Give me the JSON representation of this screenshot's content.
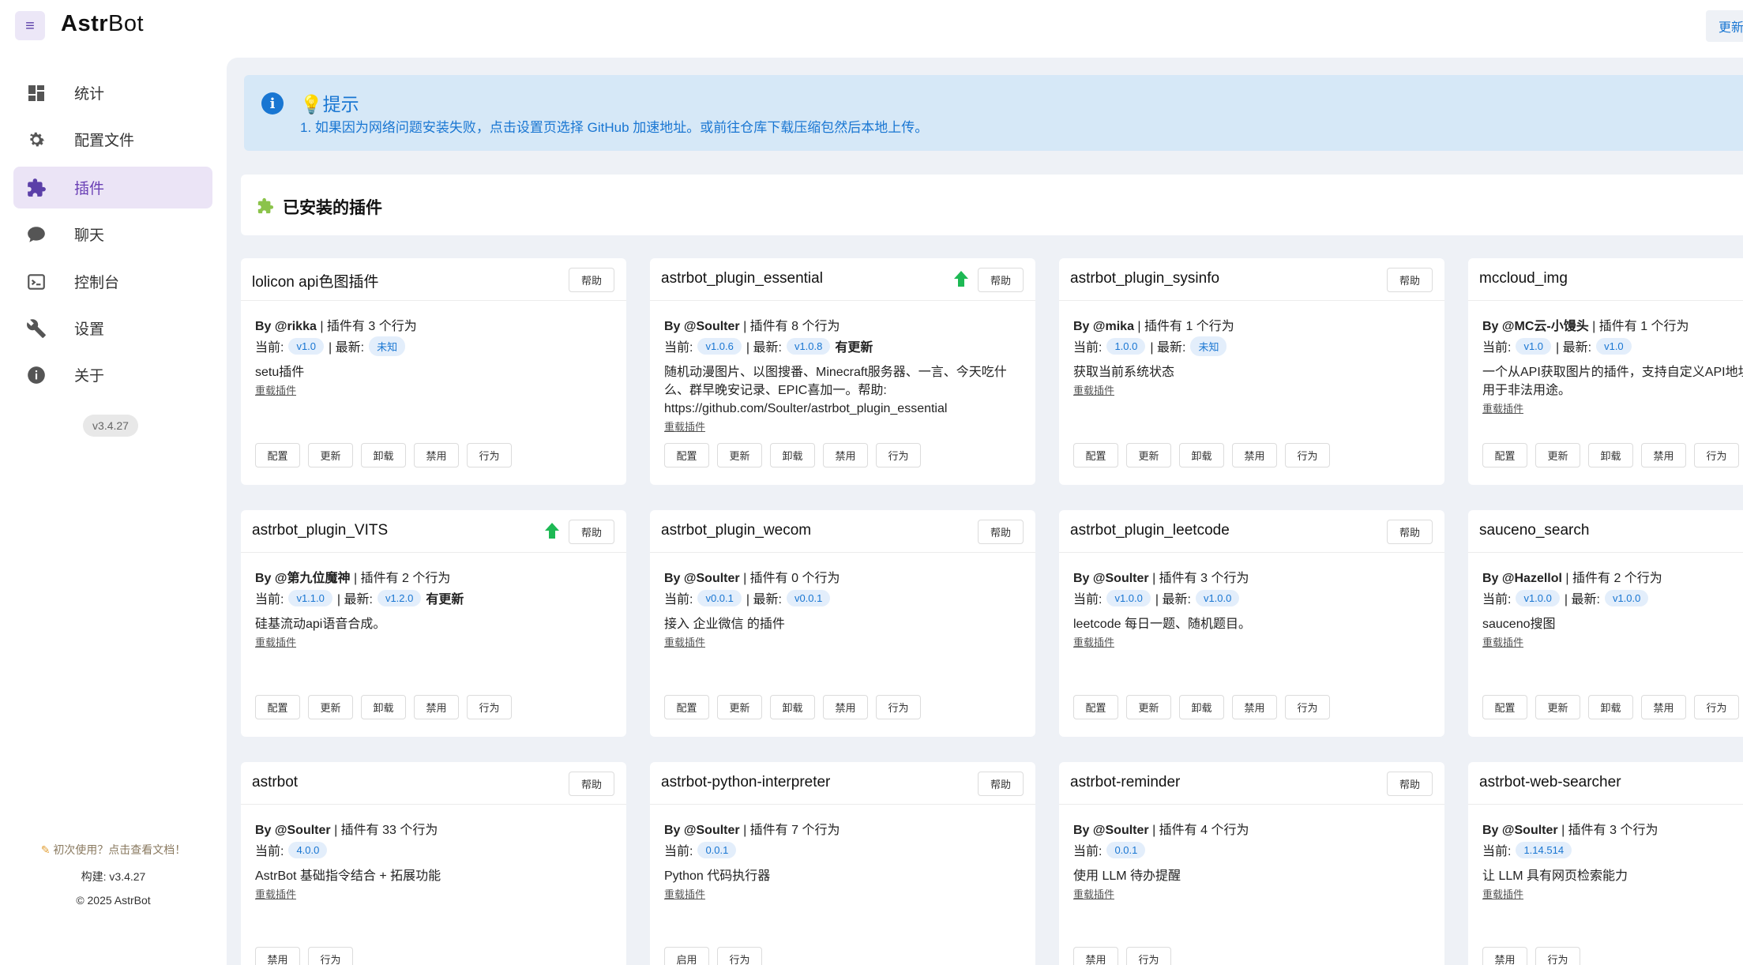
{
  "header": {
    "menu_icon": "≡",
    "logo_bold": "Astr",
    "logo_rest": "Bot",
    "update_label": "更新"
  },
  "sidebar": {
    "items": [
      {
        "label": "统计",
        "icon": "dashboard-icon"
      },
      {
        "label": "配置文件",
        "icon": "gear-icon"
      },
      {
        "label": "插件",
        "icon": "puzzle-icon"
      },
      {
        "label": "聊天",
        "icon": "chat-icon"
      },
      {
        "label": "控制台",
        "icon": "console-icon"
      },
      {
        "label": "设置",
        "icon": "wrench-icon"
      },
      {
        "label": "关于",
        "icon": "info-icon"
      }
    ],
    "version": "v3.4.27",
    "doc_hint": "初次使用？点击查看文档！",
    "build": "构建: v3.4.27",
    "copyright": "© 2025 AstrBot"
  },
  "alert": {
    "title": "提示",
    "text": "1. 如果因为网络问题安装失败，点击设置页选择 GitHub 加速地址。或前往仓库下载压缩包然后本地上传。"
  },
  "installed": {
    "title": "已安装的插件"
  },
  "labels": {
    "help": "帮助",
    "by": "By ",
    "has": " | 插件有 ",
    "behaviors": " 个行为",
    "current": "当前: ",
    "latest": "| 最新: ",
    "has_update": "有更新",
    "reload": "重载插件",
    "config": "配置",
    "update": "更新",
    "uninstall": "卸载",
    "disable": "禁用",
    "behavior": "行为",
    "enable": "启用"
  },
  "plugins": [
    {
      "name": "lolicon api色图插件",
      "author": "@rikka",
      "count": "3",
      "current": "v1.0",
      "latest": "未知",
      "has_update": false,
      "desc": "setu插件",
      "actions": [
        "配置",
        "更新",
        "卸载",
        "禁用",
        "行为"
      ]
    },
    {
      "name": "astrbot_plugin_essential",
      "author": "@Soulter",
      "count": "8",
      "current": "v1.0.6",
      "latest": "v1.0.8",
      "has_update": true,
      "desc": "随机动漫图片、以图搜番、Minecraft服务器、一言、今天吃什么、群早晚安记录、EPIC喜加一。帮助: https://github.com/Soulter/astrbot_plugin_essential",
      "actions": [
        "配置",
        "更新",
        "卸载",
        "禁用",
        "行为"
      ]
    },
    {
      "name": "astrbot_plugin_sysinfo",
      "author": "@mika",
      "count": "1",
      "current": "1.0.0",
      "latest": "未知",
      "has_update": false,
      "desc": "获取当前系统状态",
      "actions": [
        "配置",
        "更新",
        "卸载",
        "禁用",
        "行为"
      ]
    },
    {
      "name": "mccloud_img",
      "author": "@MC云-小馒头",
      "count": "1",
      "current": "v1.0",
      "latest": "v1.0",
      "has_update": false,
      "desc": "一个从API获取图片的插件，支持自定义API地址获取图片。禁止用于非法用途。",
      "actions": [
        "配置",
        "更新",
        "卸载",
        "禁用",
        "行为"
      ]
    },
    {
      "name": "astrbot_plugin_VITS",
      "author": "@第九位魔神",
      "count": "2",
      "current": "v1.1.0",
      "latest": "v1.2.0",
      "has_update": true,
      "desc": "硅基流动api语音合成。",
      "actions": [
        "配置",
        "更新",
        "卸载",
        "禁用",
        "行为"
      ]
    },
    {
      "name": "astrbot_plugin_wecom",
      "author": "@Soulter",
      "count": "0",
      "current": "v0.0.1",
      "latest": "v0.0.1",
      "has_update": false,
      "desc": "接入 企业微信 的插件",
      "actions": [
        "配置",
        "更新",
        "卸载",
        "禁用",
        "行为"
      ]
    },
    {
      "name": "astrbot_plugin_leetcode",
      "author": "@Soulter",
      "count": "3",
      "current": "v1.0.0",
      "latest": "v1.0.0",
      "has_update": false,
      "desc": "leetcode 每日一题、随机题目。",
      "actions": [
        "配置",
        "更新",
        "卸载",
        "禁用",
        "行为"
      ]
    },
    {
      "name": "sauceno_search",
      "author": "@Hazellol",
      "count": "2",
      "current": "v1.0.0",
      "latest": "v1.0.0",
      "has_update": false,
      "desc": "sauceno搜图",
      "actions": [
        "配置",
        "更新",
        "卸载",
        "禁用",
        "行为"
      ]
    },
    {
      "name": "astrbot",
      "author": "@Soulter",
      "count": "33",
      "current": "4.0.0",
      "latest": null,
      "has_update": false,
      "desc": "AstrBot 基础指令结合 + 拓展功能",
      "actions": [
        "禁用",
        "行为"
      ]
    },
    {
      "name": "astrbot-python-interpreter",
      "author": "@Soulter",
      "count": "7",
      "current": "0.0.1",
      "latest": null,
      "has_update": false,
      "desc": "Python 代码执行器",
      "actions": [
        "启用",
        "行为"
      ]
    },
    {
      "name": "astrbot-reminder",
      "author": "@Soulter",
      "count": "4",
      "current": "0.0.1",
      "latest": null,
      "has_update": false,
      "desc": "使用 LLM 待办提醒",
      "actions": [
        "禁用",
        "行为"
      ]
    },
    {
      "name": "astrbot-web-searcher",
      "author": "@Soulter",
      "count": "3",
      "current": "1.14.514",
      "latest": null,
      "has_update": false,
      "desc": "让 LLM 具有网页检索能力",
      "actions": [
        "禁用",
        "行为"
      ]
    }
  ]
}
